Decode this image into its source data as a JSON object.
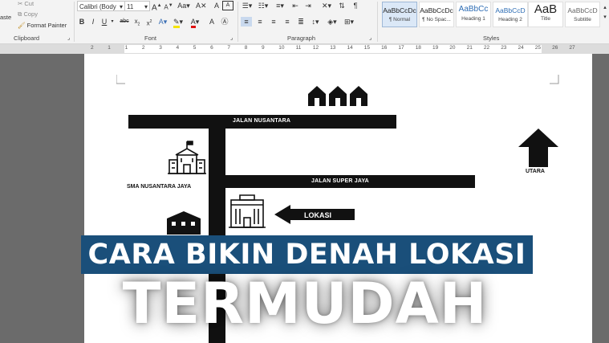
{
  "clipboard": {
    "cut": "Cut",
    "copy": "Copy",
    "format_painter": "Format Painter",
    "paste": "aste",
    "label": "Clipboard"
  },
  "font": {
    "family": "Calibri (Body",
    "size": "11",
    "label": "Font"
  },
  "paragraph": {
    "label": "Paragraph"
  },
  "styles": {
    "label": "Styles",
    "items": [
      {
        "preview": "AaBbCcDc",
        "name": "¶ Normal"
      },
      {
        "preview": "AaBbCcDc",
        "name": "¶ No Spac..."
      },
      {
        "preview": "AaBbCc",
        "name": "Heading 1"
      },
      {
        "preview": "AaBbCcD",
        "name": "Heading 2"
      },
      {
        "preview": "AaB",
        "name": "Title"
      },
      {
        "preview": "AaBbCcD",
        "name": "Subtitle"
      }
    ]
  },
  "ruler": {
    "numbers": [
      "2",
      "1",
      "1",
      "2",
      "3",
      "4",
      "5",
      "6",
      "7",
      "8",
      "9",
      "10",
      "11",
      "12",
      "13",
      "14",
      "15",
      "16",
      "17",
      "18",
      "19",
      "20",
      "21",
      "22",
      "23",
      "24",
      "25",
      "26",
      "27"
    ]
  },
  "map": {
    "road_nusantara": "JALAN NUSANTARA",
    "road_super_jaya": "JALAN SUPER JAYA",
    "school": "SMA NUSANTARA JAYA",
    "location": "LOKASI",
    "north": "UTARA"
  },
  "headline": {
    "line1": "CARA BIKIN DENAH LOKASI",
    "line2": "TERMUDAH"
  },
  "colors": {
    "banner": "#1a4f7a",
    "road": "#111111",
    "ribbon": "#f3f3f3",
    "workspace": "#6b6b6b"
  }
}
